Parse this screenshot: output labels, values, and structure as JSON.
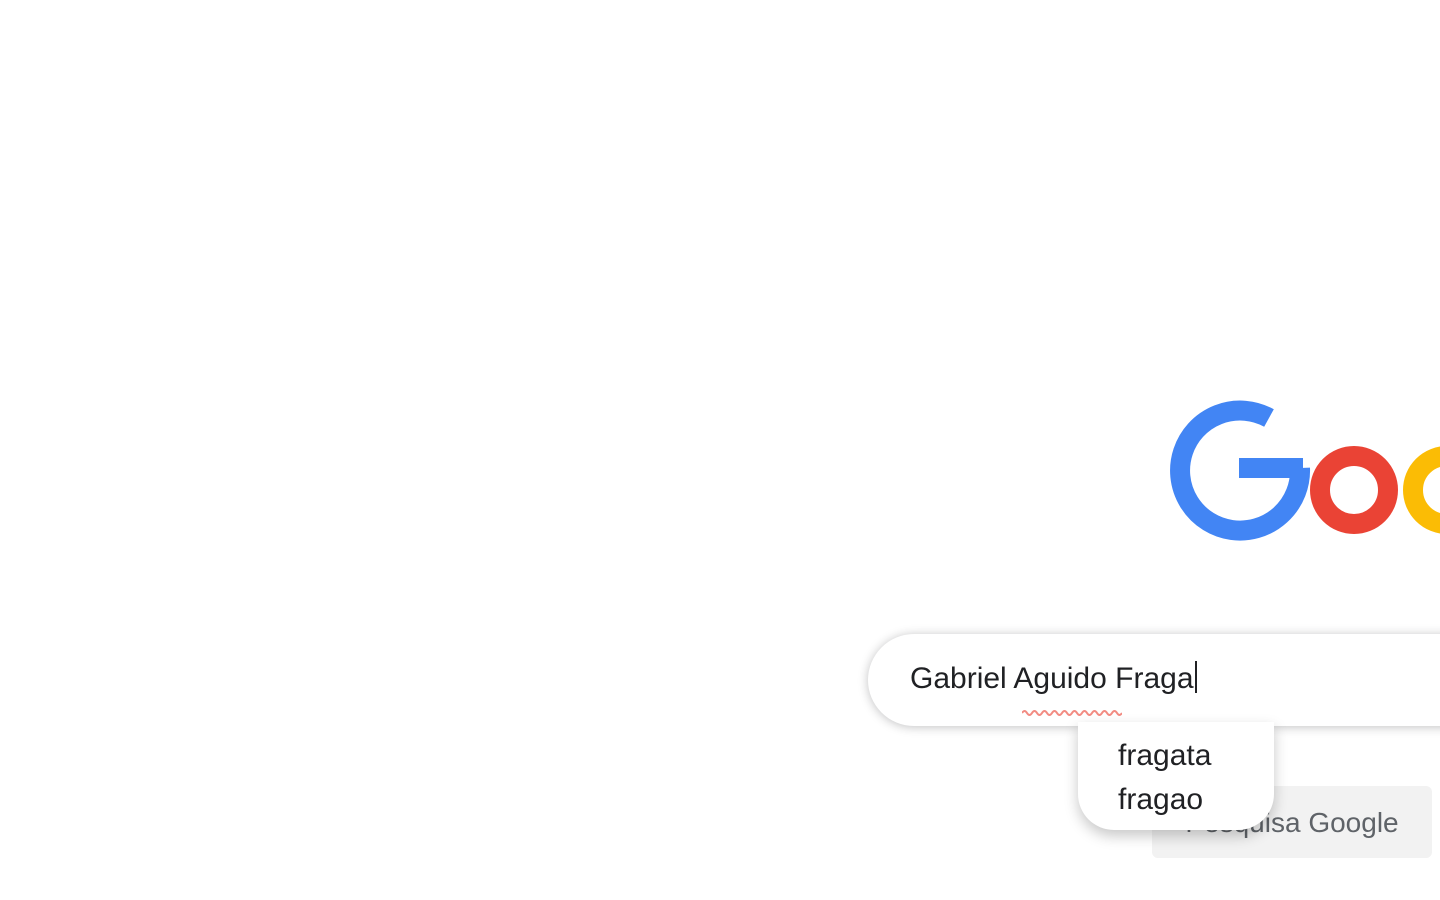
{
  "logo": {
    "alt": "Google",
    "colors": {
      "blue": "#4285F4",
      "red": "#EA4335",
      "yellow": "#FBBC05"
    }
  },
  "search": {
    "value": "Gabriel Aguido Fraga",
    "misspelled_word": "Aguido"
  },
  "spellcheck": {
    "suggestions": [
      "fragata",
      "fragao"
    ],
    "underline_color": "#F28B82"
  },
  "buttons": {
    "search_label": "Pesquisa Google"
  }
}
